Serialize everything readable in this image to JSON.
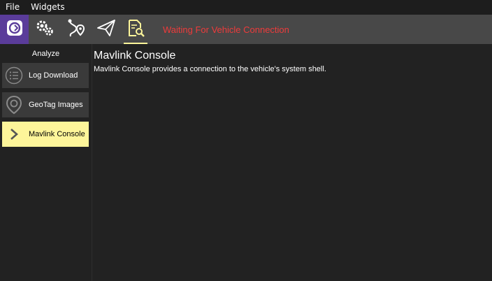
{
  "menubar": {
    "file": "File",
    "widgets": "Widgets"
  },
  "toolbar": {
    "icons": [
      "qgc-logo-icon",
      "gears-icon",
      "route-waypoint-icon",
      "paper-plane-icon",
      "analyze-document-icon"
    ],
    "status": "Waiting For Vehicle Connection",
    "status_color": "#ee3b3b",
    "accent": "#5a3c9a"
  },
  "sidebar": {
    "header": "Analyze",
    "items": [
      {
        "label": "Log Download",
        "icon": "list-icon",
        "selected": false
      },
      {
        "label": "GeoTag Images",
        "icon": "map-pin-icon",
        "selected": false
      },
      {
        "label": "Mavlink Console",
        "icon": "chevron-right-icon",
        "selected": true
      }
    ],
    "selected_color": "#fdf59a"
  },
  "main": {
    "title": "Mavlink Console",
    "description": "Mavlink Console provides a connection to the vehicle's system shell."
  }
}
